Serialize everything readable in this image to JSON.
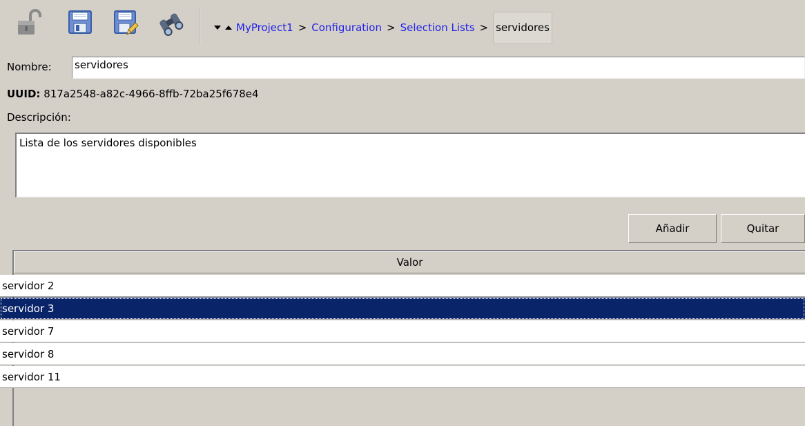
{
  "toolbar": {
    "icons": [
      "lock-open-icon",
      "save-icon",
      "save-as-icon",
      "binoculars-icon"
    ]
  },
  "breadcrumb": {
    "items": [
      "MyProject1",
      "Configuration",
      "Selection Lists"
    ],
    "separator": ">",
    "current": "servidores"
  },
  "form": {
    "name_label": "Nombre:",
    "name_value": "servidores",
    "uuid_label": "UUID:",
    "uuid_value": "817a2548-a82c-4966-8ffb-72ba25f678e4",
    "description_label": "Descripción:",
    "description_value": "Lista de los servidores disponibles"
  },
  "buttons": {
    "add_label": "Añadir",
    "remove_label": "Quitar"
  },
  "table": {
    "header": "Valor",
    "rows": [
      "servidor 2",
      "servidor 3",
      "servidor 7",
      "servidor 8",
      "servidor 11"
    ],
    "selected_row": "servidor 3"
  },
  "colors": {
    "selection": "#0a246a",
    "link": "#2121e8",
    "background": "#d4d0c8"
  }
}
